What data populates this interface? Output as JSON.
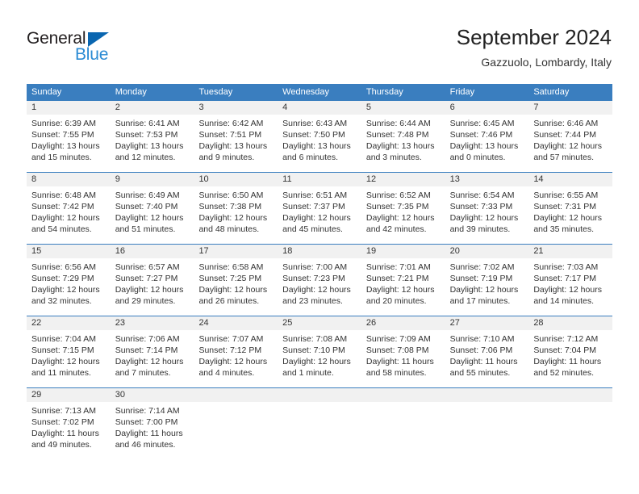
{
  "brand": {
    "name_part1": "General",
    "name_part2": "Blue",
    "triangle_color": "#0a66b0",
    "blue_color": "#2b8bd4"
  },
  "header": {
    "title": "September 2024",
    "subtitle": "Gazzuolo, Lombardy, Italy"
  },
  "theme": {
    "header_blue": "#3a7ebf",
    "daynum_band": "#f1f1f1",
    "text": "#333333"
  },
  "weekdays": [
    "Sunday",
    "Monday",
    "Tuesday",
    "Wednesday",
    "Thursday",
    "Friday",
    "Saturday"
  ],
  "weeks": [
    [
      {
        "day": "1",
        "sunrise": "Sunrise: 6:39 AM",
        "sunset": "Sunset: 7:55 PM",
        "daylight1": "Daylight: 13 hours",
        "daylight2": "and 15 minutes."
      },
      {
        "day": "2",
        "sunrise": "Sunrise: 6:41 AM",
        "sunset": "Sunset: 7:53 PM",
        "daylight1": "Daylight: 13 hours",
        "daylight2": "and 12 minutes."
      },
      {
        "day": "3",
        "sunrise": "Sunrise: 6:42 AM",
        "sunset": "Sunset: 7:51 PM",
        "daylight1": "Daylight: 13 hours",
        "daylight2": "and 9 minutes."
      },
      {
        "day": "4",
        "sunrise": "Sunrise: 6:43 AM",
        "sunset": "Sunset: 7:50 PM",
        "daylight1": "Daylight: 13 hours",
        "daylight2": "and 6 minutes."
      },
      {
        "day": "5",
        "sunrise": "Sunrise: 6:44 AM",
        "sunset": "Sunset: 7:48 PM",
        "daylight1": "Daylight: 13 hours",
        "daylight2": "and 3 minutes."
      },
      {
        "day": "6",
        "sunrise": "Sunrise: 6:45 AM",
        "sunset": "Sunset: 7:46 PM",
        "daylight1": "Daylight: 13 hours",
        "daylight2": "and 0 minutes."
      },
      {
        "day": "7",
        "sunrise": "Sunrise: 6:46 AM",
        "sunset": "Sunset: 7:44 PM",
        "daylight1": "Daylight: 12 hours",
        "daylight2": "and 57 minutes."
      }
    ],
    [
      {
        "day": "8",
        "sunrise": "Sunrise: 6:48 AM",
        "sunset": "Sunset: 7:42 PM",
        "daylight1": "Daylight: 12 hours",
        "daylight2": "and 54 minutes."
      },
      {
        "day": "9",
        "sunrise": "Sunrise: 6:49 AM",
        "sunset": "Sunset: 7:40 PM",
        "daylight1": "Daylight: 12 hours",
        "daylight2": "and 51 minutes."
      },
      {
        "day": "10",
        "sunrise": "Sunrise: 6:50 AM",
        "sunset": "Sunset: 7:38 PM",
        "daylight1": "Daylight: 12 hours",
        "daylight2": "and 48 minutes."
      },
      {
        "day": "11",
        "sunrise": "Sunrise: 6:51 AM",
        "sunset": "Sunset: 7:37 PM",
        "daylight1": "Daylight: 12 hours",
        "daylight2": "and 45 minutes."
      },
      {
        "day": "12",
        "sunrise": "Sunrise: 6:52 AM",
        "sunset": "Sunset: 7:35 PM",
        "daylight1": "Daylight: 12 hours",
        "daylight2": "and 42 minutes."
      },
      {
        "day": "13",
        "sunrise": "Sunrise: 6:54 AM",
        "sunset": "Sunset: 7:33 PM",
        "daylight1": "Daylight: 12 hours",
        "daylight2": "and 39 minutes."
      },
      {
        "day": "14",
        "sunrise": "Sunrise: 6:55 AM",
        "sunset": "Sunset: 7:31 PM",
        "daylight1": "Daylight: 12 hours",
        "daylight2": "and 35 minutes."
      }
    ],
    [
      {
        "day": "15",
        "sunrise": "Sunrise: 6:56 AM",
        "sunset": "Sunset: 7:29 PM",
        "daylight1": "Daylight: 12 hours",
        "daylight2": "and 32 minutes."
      },
      {
        "day": "16",
        "sunrise": "Sunrise: 6:57 AM",
        "sunset": "Sunset: 7:27 PM",
        "daylight1": "Daylight: 12 hours",
        "daylight2": "and 29 minutes."
      },
      {
        "day": "17",
        "sunrise": "Sunrise: 6:58 AM",
        "sunset": "Sunset: 7:25 PM",
        "daylight1": "Daylight: 12 hours",
        "daylight2": "and 26 minutes."
      },
      {
        "day": "18",
        "sunrise": "Sunrise: 7:00 AM",
        "sunset": "Sunset: 7:23 PM",
        "daylight1": "Daylight: 12 hours",
        "daylight2": "and 23 minutes."
      },
      {
        "day": "19",
        "sunrise": "Sunrise: 7:01 AM",
        "sunset": "Sunset: 7:21 PM",
        "daylight1": "Daylight: 12 hours",
        "daylight2": "and 20 minutes."
      },
      {
        "day": "20",
        "sunrise": "Sunrise: 7:02 AM",
        "sunset": "Sunset: 7:19 PM",
        "daylight1": "Daylight: 12 hours",
        "daylight2": "and 17 minutes."
      },
      {
        "day": "21",
        "sunrise": "Sunrise: 7:03 AM",
        "sunset": "Sunset: 7:17 PM",
        "daylight1": "Daylight: 12 hours",
        "daylight2": "and 14 minutes."
      }
    ],
    [
      {
        "day": "22",
        "sunrise": "Sunrise: 7:04 AM",
        "sunset": "Sunset: 7:15 PM",
        "daylight1": "Daylight: 12 hours",
        "daylight2": "and 11 minutes."
      },
      {
        "day": "23",
        "sunrise": "Sunrise: 7:06 AM",
        "sunset": "Sunset: 7:14 PM",
        "daylight1": "Daylight: 12 hours",
        "daylight2": "and 7 minutes."
      },
      {
        "day": "24",
        "sunrise": "Sunrise: 7:07 AM",
        "sunset": "Sunset: 7:12 PM",
        "daylight1": "Daylight: 12 hours",
        "daylight2": "and 4 minutes."
      },
      {
        "day": "25",
        "sunrise": "Sunrise: 7:08 AM",
        "sunset": "Sunset: 7:10 PM",
        "daylight1": "Daylight: 12 hours",
        "daylight2": "and 1 minute."
      },
      {
        "day": "26",
        "sunrise": "Sunrise: 7:09 AM",
        "sunset": "Sunset: 7:08 PM",
        "daylight1": "Daylight: 11 hours",
        "daylight2": "and 58 minutes."
      },
      {
        "day": "27",
        "sunrise": "Sunrise: 7:10 AM",
        "sunset": "Sunset: 7:06 PM",
        "daylight1": "Daylight: 11 hours",
        "daylight2": "and 55 minutes."
      },
      {
        "day": "28",
        "sunrise": "Sunrise: 7:12 AM",
        "sunset": "Sunset: 7:04 PM",
        "daylight1": "Daylight: 11 hours",
        "daylight2": "and 52 minutes."
      }
    ],
    [
      {
        "day": "29",
        "sunrise": "Sunrise: 7:13 AM",
        "sunset": "Sunset: 7:02 PM",
        "daylight1": "Daylight: 11 hours",
        "daylight2": "and 49 minutes."
      },
      {
        "day": "30",
        "sunrise": "Sunrise: 7:14 AM",
        "sunset": "Sunset: 7:00 PM",
        "daylight1": "Daylight: 11 hours",
        "daylight2": "and 46 minutes."
      },
      {
        "day": "",
        "sunrise": "",
        "sunset": "",
        "daylight1": "",
        "daylight2": ""
      },
      {
        "day": "",
        "sunrise": "",
        "sunset": "",
        "daylight1": "",
        "daylight2": ""
      },
      {
        "day": "",
        "sunrise": "",
        "sunset": "",
        "daylight1": "",
        "daylight2": ""
      },
      {
        "day": "",
        "sunrise": "",
        "sunset": "",
        "daylight1": "",
        "daylight2": ""
      },
      {
        "day": "",
        "sunrise": "",
        "sunset": "",
        "daylight1": "",
        "daylight2": ""
      }
    ]
  ]
}
